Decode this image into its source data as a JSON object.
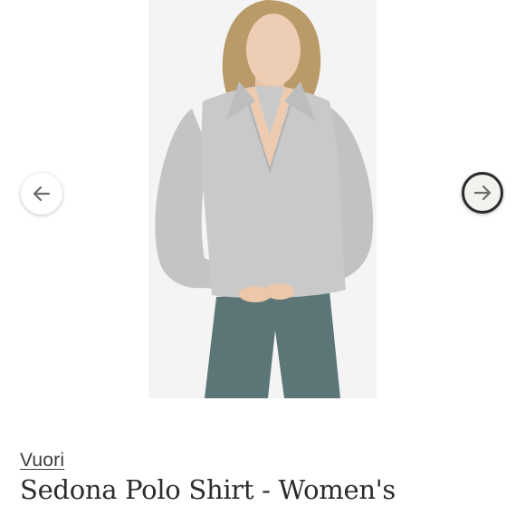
{
  "gallery": {
    "image_alt": "Model wearing Sedona Polo Shirt",
    "prev_icon": "arrow-left-icon",
    "next_icon": "arrow-right-icon"
  },
  "product": {
    "brand": "Vuori",
    "title": "Sedona Polo Shirt - Women's"
  },
  "colors": {
    "shirt": "#c9c9c9",
    "leggings": "#5c7677",
    "background": "#f4f4f5"
  }
}
